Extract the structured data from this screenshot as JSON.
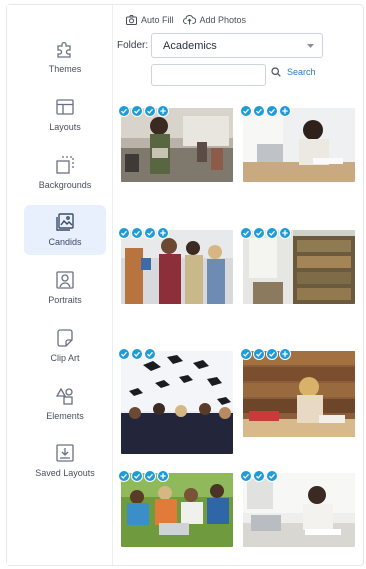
{
  "sidebar": {
    "items": [
      {
        "label": "Themes",
        "icon": "puzzle-icon",
        "active": false
      },
      {
        "label": "Layouts",
        "icon": "layout-icon",
        "active": false
      },
      {
        "label": "Backgrounds",
        "icon": "background-icon",
        "active": false
      },
      {
        "label": "Candids",
        "icon": "image-icon",
        "active": true
      },
      {
        "label": "Portraits",
        "icon": "portrait-icon",
        "active": false
      },
      {
        "label": "Clip Art",
        "icon": "sticker-icon",
        "active": false
      },
      {
        "label": "Elements",
        "icon": "shapes-icon",
        "active": false
      },
      {
        "label": "Saved Layouts",
        "icon": "download-box-icon",
        "active": false
      }
    ]
  },
  "toolbar": {
    "auto_fill_label": "Auto Fill",
    "add_photos_label": "Add Photos"
  },
  "folder": {
    "label": "Folder:",
    "selected": "Academics"
  },
  "search": {
    "placeholder": "",
    "value": "",
    "button_label": "Search"
  },
  "photos": [
    {
      "subject": "teacher in classroom",
      "checks": 3,
      "plus": true
    },
    {
      "subject": "student writing at laptop",
      "checks": 3,
      "plus": true
    },
    {
      "subject": "students holding books",
      "checks": 3,
      "plus": true
    },
    {
      "subject": "library bookshelves",
      "checks": 3,
      "plus": true
    },
    {
      "subject": "graduation caps thrown",
      "checks": 3,
      "plus": false
    },
    {
      "subject": "girl reading in library",
      "checks": 3,
      "plus": true
    },
    {
      "subject": "students studying on grass",
      "checks": 3,
      "plus": true
    },
    {
      "subject": "student with headphones writing",
      "checks": 3,
      "plus": false
    }
  ],
  "colors": {
    "accent": "#2c79c9",
    "badge": "#1f9bd8",
    "active_bg": "#e9f0fd"
  }
}
